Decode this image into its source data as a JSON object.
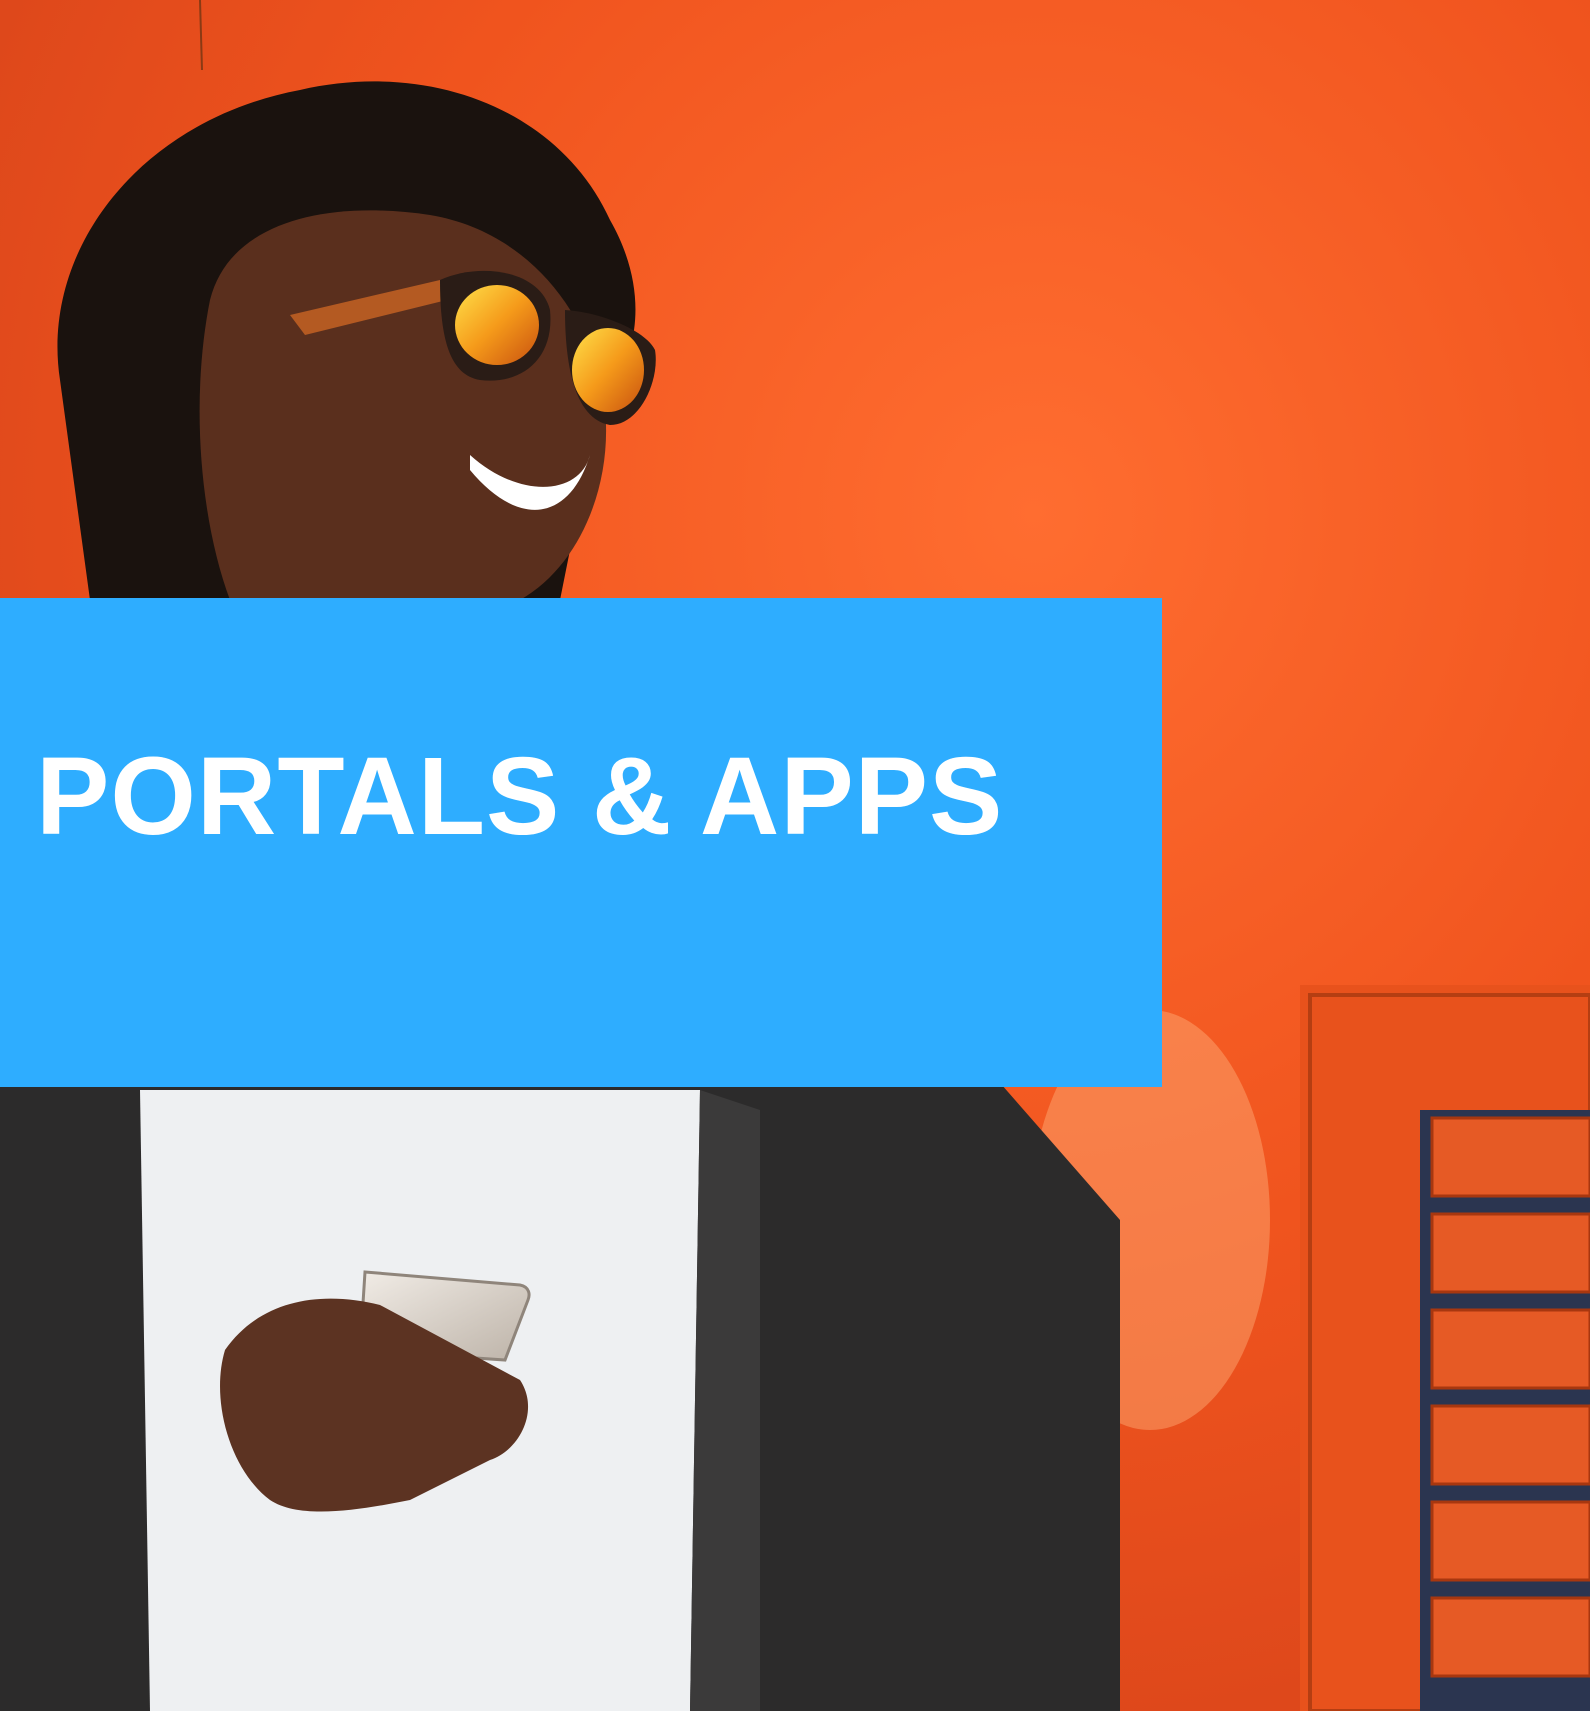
{
  "banner": {
    "title": "PORTALS & APPS",
    "background_color": "#2eadff",
    "text_color": "#ffffff"
  },
  "photo": {
    "wall_color": "#f05a24",
    "subjects": [
      "person-with-sunglasses",
      "smartphone",
      "window-shutter"
    ]
  }
}
